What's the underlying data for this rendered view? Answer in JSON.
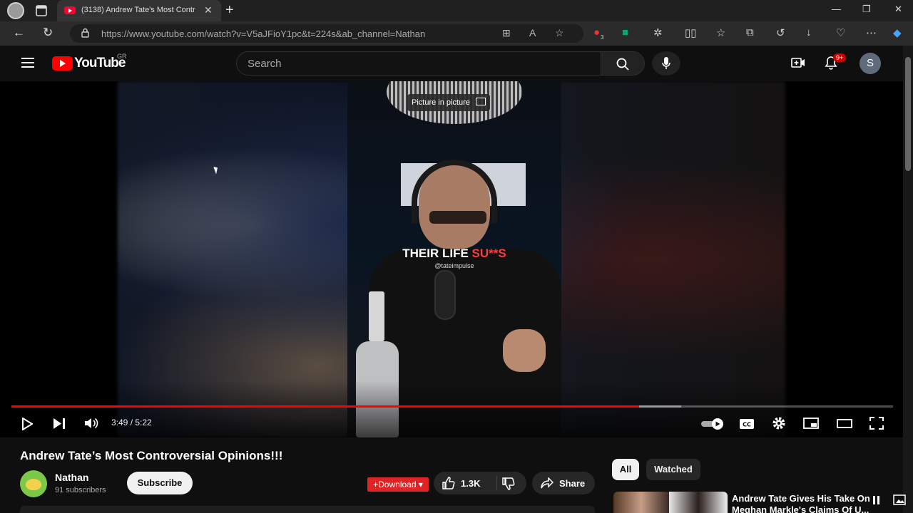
{
  "browser": {
    "tab_title": "(3138) Andrew Tate's Most Contr",
    "url": "https://www.youtube.com/watch?v=V5aJFioY1pc&t=224s&ab_channel=Nathan",
    "extension_badge": "3"
  },
  "youtube": {
    "logo_text": "YouTube",
    "country_code": "GR",
    "search_placeholder": "Search",
    "notification_count": "9+",
    "avatar_letter": "S"
  },
  "player": {
    "pip_tooltip": "Picture in picture",
    "caption_white": "THEIR LIFE ",
    "caption_red": "SU**S",
    "caption_watermark": "@tateimpulse",
    "time": "3:49 / 5:22",
    "progress_played": 0.712,
    "progress_buffered": 0.76
  },
  "video": {
    "title": "Andrew Tate’s Most Controversial Opinions!!!",
    "channel_name": "Nathan",
    "channel_subs": "91 subscribers",
    "subscribe_label": "Subscribe",
    "download_label": "Download",
    "like_count": "1.3K",
    "share_label": "Share"
  },
  "sidebar": {
    "chips": [
      "All",
      "Watched"
    ],
    "rec_title": "Andrew Tate Gives His Take On Meghan Markle's Claims Of U..."
  },
  "colors": {
    "accent": "#ff0000",
    "background": "#0f0f0f",
    "chip_active": "#f1f1f1"
  }
}
